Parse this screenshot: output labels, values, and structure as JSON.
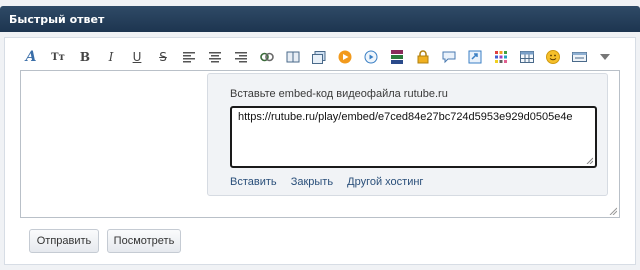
{
  "header": {
    "title": "Быстрый ответ"
  },
  "toolbar": {
    "buttons": [
      {
        "name": "font-style-icon",
        "glyph": "A"
      },
      {
        "name": "font-size-icon",
        "glyph": "Tт"
      },
      {
        "name": "bold-icon",
        "glyph": "B"
      },
      {
        "name": "italic-icon",
        "glyph": "I"
      },
      {
        "name": "underline-icon",
        "glyph": "U"
      },
      {
        "name": "strikethrough-icon",
        "glyph": "S"
      },
      {
        "name": "align-left-icon",
        "glyph": ""
      },
      {
        "name": "align-center-icon",
        "glyph": ""
      },
      {
        "name": "align-right-icon",
        "glyph": ""
      },
      {
        "name": "link-icon",
        "glyph": ""
      },
      {
        "name": "book-icon",
        "glyph": ""
      },
      {
        "name": "image-icon",
        "glyph": ""
      },
      {
        "name": "video-play-icon",
        "glyph": ""
      },
      {
        "name": "media-play-icon",
        "glyph": ""
      },
      {
        "name": "archive-icon",
        "glyph": ""
      },
      {
        "name": "lock-icon",
        "glyph": ""
      },
      {
        "name": "speech-bubble-icon",
        "glyph": ""
      },
      {
        "name": "insert-icon",
        "glyph": ""
      },
      {
        "name": "color-grid-icon",
        "glyph": ""
      },
      {
        "name": "table-icon",
        "glyph": ""
      },
      {
        "name": "smiley-icon",
        "glyph": ""
      },
      {
        "name": "keyboard-icon",
        "glyph": ""
      },
      {
        "name": "more-dropdown-icon",
        "glyph": ""
      }
    ]
  },
  "embed_popup": {
    "label": "Вставьте embed-код видеофайла rutube.ru",
    "url_value": "https://rutube.ru/play/embed/e7ced84e27bc724d5953e929d0505e4e",
    "insert_label": "Вставить",
    "close_label": "Закрыть",
    "other_host_label": "Другой хостинг"
  },
  "actions": {
    "send_label": "Отправить",
    "preview_label": "Посмотреть"
  },
  "colors": {
    "header_bg": "#1d3550",
    "link": "#2a4f7a",
    "orange": "#f29a1d",
    "blue": "#3a7fc4",
    "green": "#4a9a3a"
  }
}
